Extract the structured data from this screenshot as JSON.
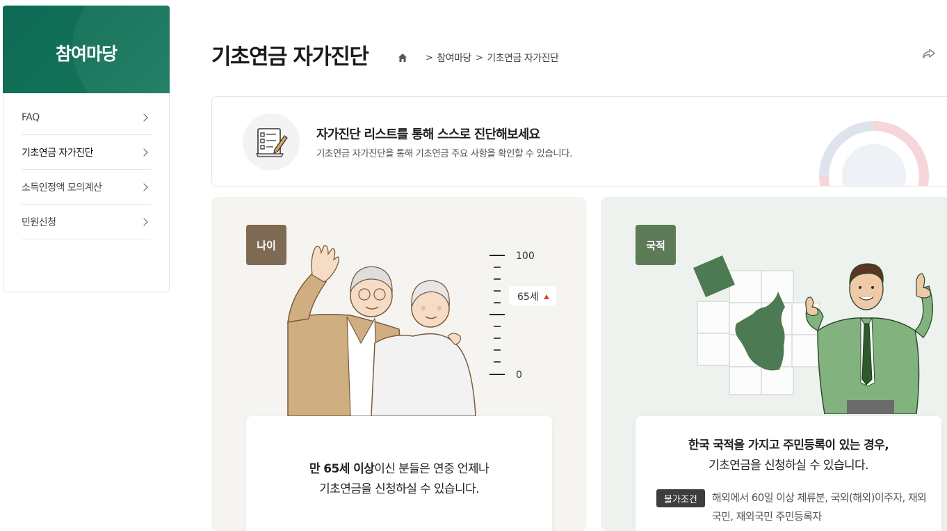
{
  "sidebar": {
    "title": "참여마당",
    "items": [
      {
        "label": "FAQ"
      },
      {
        "label": "기초연금 자가진단"
      },
      {
        "label": "소득인정액 모의계산"
      },
      {
        "label": "민원신청"
      }
    ]
  },
  "header": {
    "title": "기초연금 자가진단",
    "breadcrumb": [
      "참여마당",
      "기초연금 자가진단"
    ]
  },
  "banner": {
    "heading": "자가진단 리스트를 통해 스스로 진단해보세요",
    "subtext": "기초연금 자가진단을 통해 기초연금 주요 사항을 확인할 수 있습니다."
  },
  "cards": {
    "age": {
      "badge": "나이",
      "scale_top": "100",
      "scale_bottom": "0",
      "marker": "65세",
      "text_bold": "만 65세 이상",
      "text_rest": "이신 분들은 연중 언제나",
      "text_line2": "기초연금을 신청하실 수 있습니다."
    },
    "nationality": {
      "badge": "국적",
      "text_bold": "한국 국적을 가지고 주민등록이 있는 경우,",
      "text_line2": "기초연금을 신청하실 수 있습니다.",
      "condition_label": "불가조건",
      "condition_text": "해외에서 60일 이상 체류분, 국외(해외)이주자, 재외국민, 재외국민 주민등록자"
    }
  },
  "colors": {
    "sidebar_green": "#127258",
    "badge_age": "#7f6b53",
    "badge_nat": "#5e7b58",
    "marker_red": "#e2452b"
  }
}
